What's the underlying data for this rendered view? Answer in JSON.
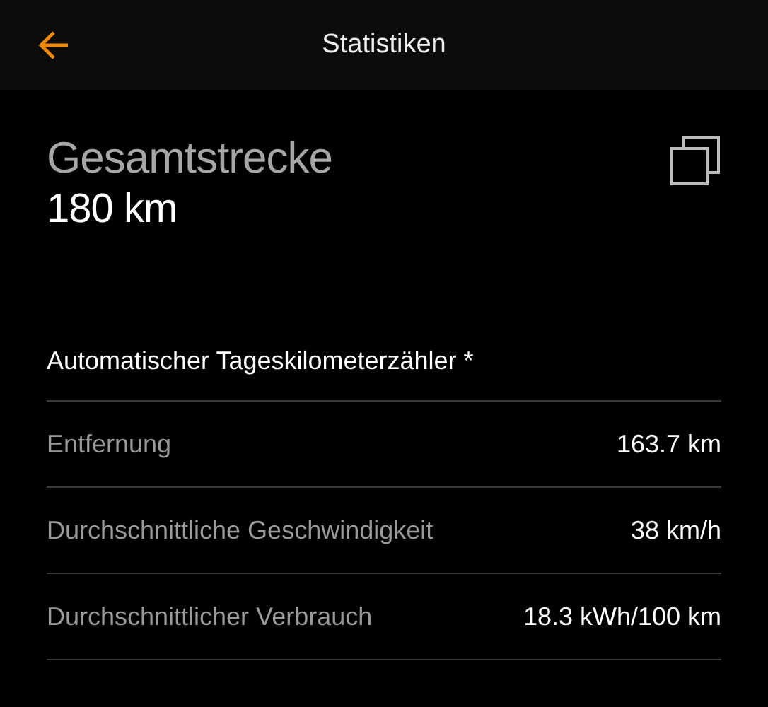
{
  "header": {
    "title": "Statistiken"
  },
  "total": {
    "label": "Gesamtstrecke",
    "value": "180 km"
  },
  "section": {
    "title": "Automatischer Tageskilometerzähler *",
    "rows": [
      {
        "label": "Entfernung",
        "value": "163.7 km"
      },
      {
        "label": "Durchschnittliche Geschwindigkeit",
        "value": "38 km/h"
      },
      {
        "label": "Durchschnittlicher Verbrauch",
        "value": "18.3 kWh/100 km"
      }
    ]
  }
}
